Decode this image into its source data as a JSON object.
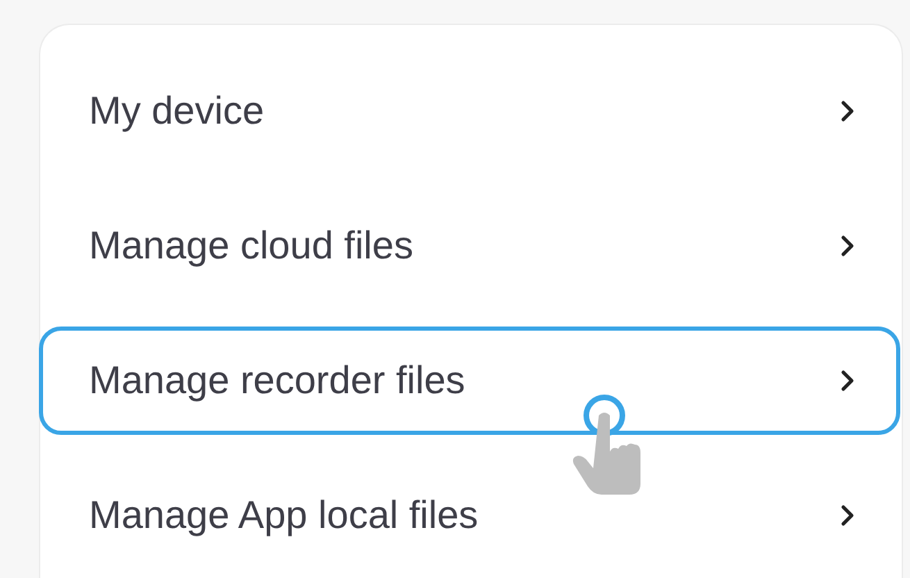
{
  "menu": {
    "items": [
      {
        "label": "My device",
        "highlighted": false
      },
      {
        "label": "Manage cloud files",
        "highlighted": false
      },
      {
        "label": "Manage recorder files",
        "highlighted": true
      },
      {
        "label": "Manage App local files",
        "highlighted": false
      }
    ]
  }
}
